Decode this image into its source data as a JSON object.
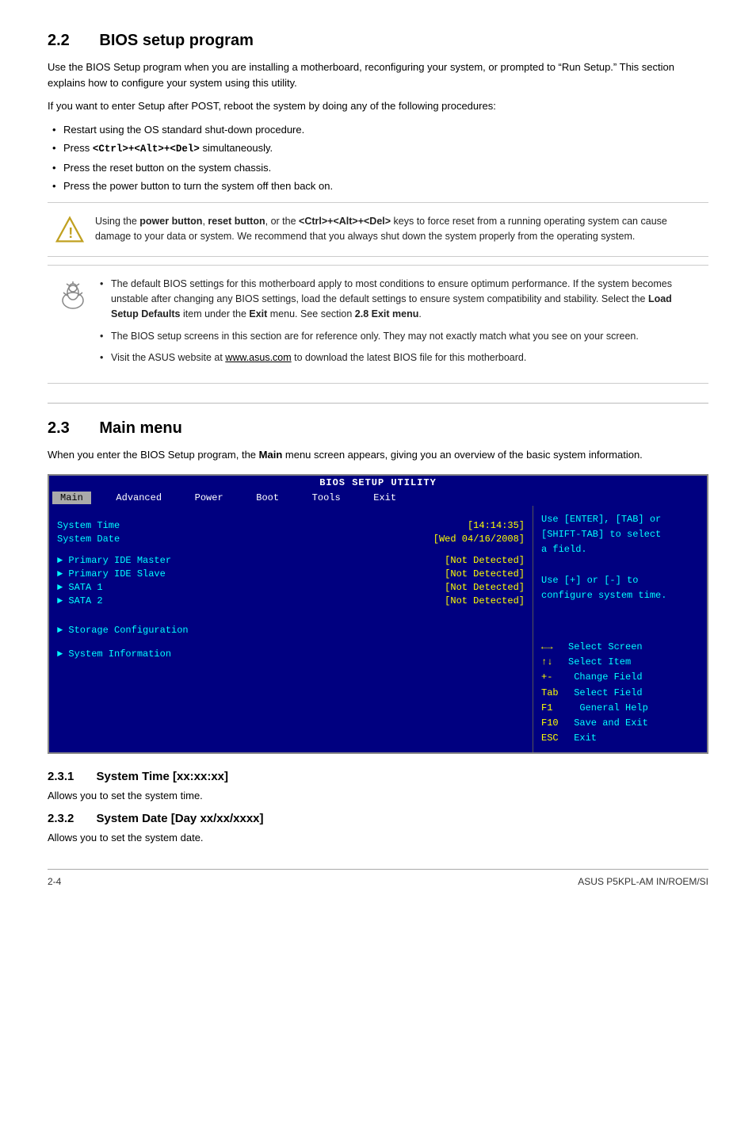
{
  "sections": {
    "s22": {
      "num": "2.2",
      "title": "BIOS setup program",
      "intro1": "Use the BIOS Setup program when you are installing a motherboard, reconfiguring your system, or prompted to “Run Setup.” This section explains how to configure your system using this utility.",
      "intro2": "If you want to enter Setup after POST, reboot the system by doing any of the following procedures:",
      "bullets": [
        "Restart using the OS standard shut-down procedure.",
        "Press <Ctrl>+<Alt>+<Del> simultaneously.",
        "Press the reset button on the system chassis.",
        "Press the power button to turn the system off then back on."
      ],
      "warning_text": "Using the power button, reset button, or the <Ctrl>+<Alt>+<Del> keys to force reset from a running operating system can cause damage to your data or system. We recommend that you always shut down the system properly from the operating system.",
      "notes": [
        "The default BIOS settings for this motherboard apply to most conditions to ensure optimum performance. If the system becomes unstable after changing any BIOS settings, load the default settings to ensure system compatibility and stability. Select the Load Setup Defaults item under the Exit menu. See section 2.8 Exit menu.",
        "The BIOS setup screens in this section are for reference only. They may not exactly match what you see on your screen.",
        "Visit the ASUS website at www.asus.com to download the latest BIOS file for this motherboard."
      ]
    },
    "s23": {
      "num": "2.3",
      "title": "Main menu",
      "intro": "When you enter the BIOS Setup program, the Main menu screen appears, giving you an overview of the basic system information.",
      "bios": {
        "title": "BIOS SETUP UTILITY",
        "menu_items": [
          "Main",
          "Advanced",
          "Power",
          "Boot",
          "Tools",
          "Exit"
        ],
        "active_menu": "Main",
        "fields": [
          {
            "label": "System Time",
            "value": "[14:14:35]"
          },
          {
            "label": "System Date",
            "value": "[Wed 04/16/2008]"
          }
        ],
        "devices": [
          {
            "label": "► Primary IDE Master",
            "value": "[Not Detected]"
          },
          {
            "label": "► Primary IDE Slave",
            "value": "[Not Detected]"
          },
          {
            "label": "► SATA 1",
            "value": "[Not Detected]"
          },
          {
            "label": "► SATA 2",
            "value": "[Not Detected]"
          }
        ],
        "submenus": [
          "► Storage Configuration",
          "► System Information"
        ],
        "help_text": "Use [ENTER], [TAB] or\n[SHIFT-TAB] to select\na field.\n\nUse [+] or [-] to\nconfigure system time.",
        "keys": [
          {
            "sym": "←→",
            "desc": "Select Screen"
          },
          {
            "sym": "↑↓",
            "desc": "Select Item"
          },
          {
            "sym": "+-",
            "desc": "Change Field"
          },
          {
            "sym": "Tab",
            "desc": "Select Field"
          },
          {
            "sym": "F1",
            "desc": "General Help"
          },
          {
            "sym": "F10",
            "desc": "Save and Exit"
          },
          {
            "sym": "ESC",
            "desc": "Exit"
          }
        ]
      }
    },
    "s231": {
      "num": "2.3.1",
      "title": "System Time [xx:xx:xx]",
      "desc": "Allows you to set the system time."
    },
    "s232": {
      "num": "2.3.2",
      "title": "System Date [Day xx/xx/xxxx]",
      "desc": "Allows you to set the system date."
    }
  },
  "footer": {
    "left": "2-4",
    "right": "ASUS P5KPL-AM IN/ROEM/SI"
  }
}
